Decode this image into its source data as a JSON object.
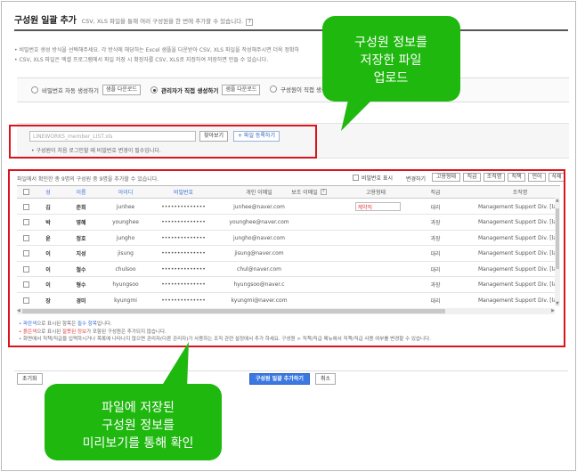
{
  "header": {
    "title": "구성원 일괄 추가",
    "subtitle": "CSV, XLS 파일을 통해 여러 구성원을 한 번에 추가할 수 있습니다.",
    "help": "?"
  },
  "notes": [
    "• 비밀번호 생성 방식을 선택해주세요. 각 방식에 해당하는 Excel 샘플을 다운받아 CSV, XLS 파일을 작성해주시면 더욱 정확하",
    "• CSV, XLS 파일은 엑셀 프로그램에서 파일 저장 시 확장자를 CSV, XLS로 지정하여 저장하면 만들 수 있습니다."
  ],
  "methods": [
    {
      "label": "비밀번호 자동 생성하기",
      "button": "샘플 다운로드",
      "selected": false
    },
    {
      "label": "관리자가 직접 생성하기",
      "button": "샘플 다운로드",
      "selected": true
    },
    {
      "label": "구성원이 직접 생성하",
      "selected": false
    }
  ],
  "upload": {
    "file_value": "LINEWORKS_member_LIST.xls",
    "browse_label": "찾아보기",
    "register_label": "+ 파일 등록하기",
    "hint": "• 구성원이 처음 로그인할 때 비밀번호 변경이 필수입니다."
  },
  "grid_toolbar": {
    "count_text": "파일에서 확인한 총 9명의 구성원 중 9명을 추가할 수 있습니다.",
    "password_toggle": "비밀번호 표시",
    "change_label": "변경하기",
    "change_buttons": [
      "고용형태",
      "직급",
      "조직명",
      "직책",
      "언어",
      "삭제"
    ]
  },
  "table": {
    "columns": [
      "성",
      "이름",
      "아이디",
      "비밀번호",
      "개인 이메일",
      "보조 이메일",
      "고용형태",
      "직급",
      "조직명"
    ],
    "secondary_email_help": "?",
    "rows": [
      {
        "last": "김",
        "first": "준희",
        "id": "junhee",
        "password": "••••••••••••••",
        "email": "junhee@naver.com",
        "employment": "계약직",
        "rank": "대리",
        "org": "Management Support Div. [la"
      },
      {
        "last": "박",
        "first": "영혜",
        "id": "younghee",
        "password": "••••••••••••••",
        "email": "younghee@naver.com",
        "employment": "",
        "rank": "과장",
        "org": "Management Support Div. [la"
      },
      {
        "last": "윤",
        "first": "정호",
        "id": "jungho",
        "password": "••••••••••••••",
        "email": "jungho@naver.com",
        "employment": "",
        "rank": "과장",
        "org": "Management Support Div. [la"
      },
      {
        "last": "이",
        "first": "지성",
        "id": "jisung",
        "password": "••••••••••••••",
        "email": "jisung@naver.com",
        "employment": "",
        "rank": "대리",
        "org": "Management Support Div. [la"
      },
      {
        "last": "이",
        "first": "철수",
        "id": "chulsoo",
        "password": "••••••••••••••",
        "email": "chul@naver.com",
        "employment": "",
        "rank": "대리",
        "org": "Management Support Div. [la"
      },
      {
        "last": "이",
        "first": "형수",
        "id": "hyungsoo",
        "password": "••••••••••••••",
        "email": "hyungsoo@naver.c",
        "employment": "",
        "rank": "과장",
        "org": "Management Support Div. [la"
      },
      {
        "last": "장",
        "first": "경미",
        "id": "kyungmi",
        "password": "••••••••••••••",
        "email": "kyungmi@naver.com",
        "employment": "",
        "rank": "대리",
        "org": "Management Support Div. [la"
      }
    ]
  },
  "legend": {
    "line1_a": "• 파란색",
    "line1_b": "으로 표시된 항목은 ",
    "line1_c": "필수 항목",
    "line1_d": "입니다.",
    "line2_a": "• 붉은색",
    "line2_b": "으로 표시된 ",
    "line2_c": "잘못된 정보",
    "line2_d": "가 포함된 구성원은 추가되지 않습니다.",
    "line3": "• 화면에서 직책/직급을 입력하시거나 목록에 나타나지 않으면 관리자(다른 관리자)가 사용하는 조직 관련 설정에서 추가 하세요. 구성원 > 직책/직급 메뉴에서 직책/직급 사용 여부를 변경할 수 있습니다."
  },
  "footer": {
    "reset_label": "초기화",
    "add_label": "구성원 일괄 추가하기",
    "cancel_label": "취소"
  },
  "callouts": {
    "top": [
      "구성원 정보를",
      "저장한 파일",
      "업로드"
    ],
    "bottom": [
      "파일에 저장된",
      "구성원 정보를",
      "미리보기를 통해 확인"
    ]
  },
  "colors": {
    "callout_green": "#1fb80f",
    "highlight_red": "#d8151c",
    "primary_blue": "#3b78e0",
    "required_blue": "#3a6fd8",
    "error_red": "#e53a3a"
  }
}
